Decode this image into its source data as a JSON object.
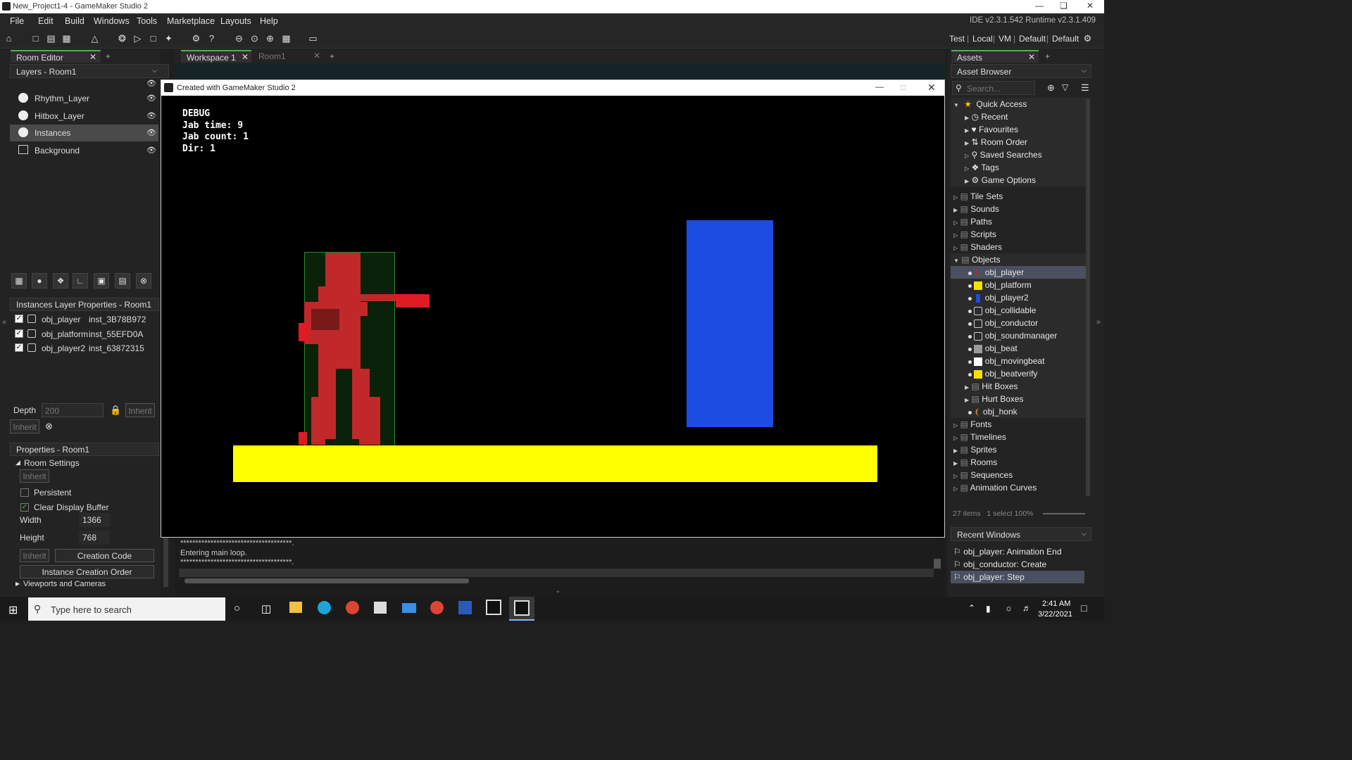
{
  "window": {
    "title": "New_Project1-4 - GameMaker Studio 2"
  },
  "menu": [
    "File",
    "Edit",
    "Build",
    "Windows",
    "Tools",
    "Marketplace",
    "Layouts",
    "Help"
  ],
  "ide_version": "IDE v2.3.1.542 Runtime v2.3.1.409",
  "targets": {
    "test": "Test",
    "local": "Local",
    "vm": "VM",
    "default1": "Default",
    "default2": "Default"
  },
  "room_editor": {
    "tab": "Room Editor",
    "layers_title": "Layers - Room1",
    "layers": [
      {
        "name": "Rhythm_Layer"
      },
      {
        "name": "Hitbox_Layer"
      },
      {
        "name": "Instances",
        "selected": true
      },
      {
        "name": "Background"
      }
    ],
    "inst_props_title": "Instances Layer Properties - Room1",
    "instances": [
      {
        "obj": "obj_player",
        "id": "inst_3B78B972"
      },
      {
        "obj": "obj_platform",
        "id": "inst_55EFD0A"
      },
      {
        "obj": "obj_player2",
        "id": "inst_63872315"
      }
    ],
    "depth_label": "Depth",
    "depth_value": "200",
    "inherit": "Inherit",
    "props_title": "Properties - Room1",
    "room_settings": "Room Settings",
    "persistent": "Persistent",
    "clear_display": "Clear Display Buffer",
    "width_label": "Width",
    "width_value": "1366",
    "height_label": "Height",
    "height_value": "768",
    "creation_code": "Creation Code",
    "instance_order": "Instance Creation Order",
    "viewports": "Viewports and Cameras"
  },
  "workspace": {
    "tab1": "Workspace 1",
    "tab2": "Room1"
  },
  "game_window": {
    "title": "Created with GameMaker Studio 2",
    "debug": [
      "DEBUG",
      "Jab time: 9",
      "Jab count: 1",
      "Dir: 1"
    ]
  },
  "output": {
    "stars1": "*************************************.",
    "line": "Entering main loop.",
    "stars2": "*************************************."
  },
  "assets": {
    "tab": "Assets",
    "browser": "Asset Browser",
    "search_placeholder": "Search...",
    "quick_access": "Quick Access",
    "quick": [
      "Recent",
      "Favourites",
      "Room Order",
      "Saved Searches",
      "Tags",
      "Game Options"
    ],
    "groups1": [
      "Tile Sets",
      "Sounds",
      "Paths",
      "Scripts",
      "Shaders"
    ],
    "objects_label": "Objects",
    "objects": [
      {
        "name": "obj_player",
        "color": "#c0282a"
      },
      {
        "name": "obj_platform",
        "color": "#f4e200"
      },
      {
        "name": "obj_player2",
        "color": "#1d4ce0"
      },
      {
        "name": "obj_collidable",
        "color": "outline"
      },
      {
        "name": "obj_conductor",
        "color": "outline"
      },
      {
        "name": "obj_soundmanager",
        "color": "outline"
      },
      {
        "name": "obj_beat",
        "color": "#9a9a9a"
      },
      {
        "name": "obj_movingbeat",
        "color": "#ffffff"
      },
      {
        "name": "obj_beatverify",
        "color": "#f4e200"
      }
    ],
    "subfolders": [
      "Hit Boxes",
      "Hurt Boxes"
    ],
    "honk": "obj_honk",
    "groups2": [
      "Fonts",
      "Timelines",
      "Sprites",
      "Rooms",
      "Sequences",
      "Animation Curves"
    ],
    "footer": "27 items   1 select 100%",
    "recent_title": "Recent Windows",
    "recent": [
      "obj_player: Animation End",
      "obj_conductor: Create",
      "obj_player: Step"
    ]
  },
  "taskbar": {
    "search": "Type here to search",
    "time": "2:41 AM",
    "date": "3/22/2021"
  }
}
